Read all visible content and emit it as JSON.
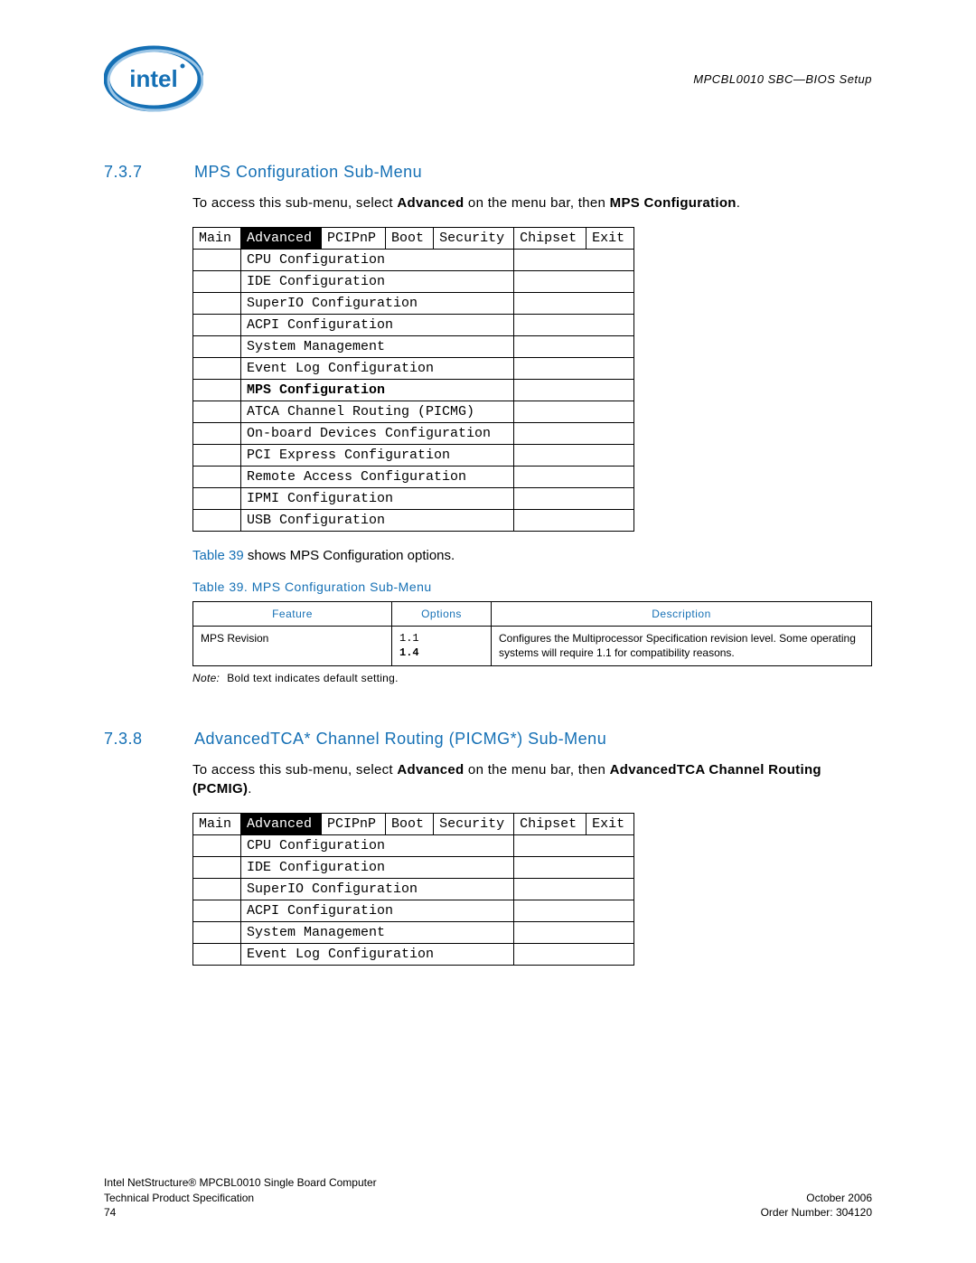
{
  "header": {
    "doc_header_right": "MPCBL0010 SBC—BIOS Setup"
  },
  "section1": {
    "number": "7.3.7",
    "title": "MPS Configuration Sub-Menu",
    "intro_prefix": "To access this sub-menu, select ",
    "intro_bold1": "Advanced",
    "intro_mid": " on the menu bar, then ",
    "intro_bold2": "MPS Configuration",
    "intro_suffix": "."
  },
  "menubar": {
    "main": "Main",
    "advanced": "Advanced",
    "pcipnp": "PCIPnP",
    "boot": "Boot",
    "security": "Security",
    "chipset": "Chipset",
    "exit": "Exit"
  },
  "menu1_items": [
    "CPU Configuration",
    "IDE Configuration",
    "SuperIO Configuration",
    "ACPI Configuration",
    "System Management",
    "Event Log Configuration",
    "MPS Configuration",
    "ATCA Channel Routing (PICMG)",
    "On-board Devices Configuration",
    "PCI Express Configuration",
    "Remote Access Configuration",
    "IPMI Configuration",
    "USB Configuration"
  ],
  "caption1": {
    "link": "Table 39",
    "rest": " shows MPS Configuration options."
  },
  "table39": {
    "caption": "Table 39.   MPS Configuration Sub-Menu",
    "headers": {
      "feature": "Feature",
      "options": "Options",
      "description": "Description"
    },
    "row": {
      "feature": "MPS Revision",
      "opt1": "1.1",
      "opt2": "1.4",
      "desc": "Configures the Multiprocessor Specification revision level. Some operating systems will require 1.1 for compatibility reasons."
    }
  },
  "note": {
    "label": "Note:",
    "text": "Bold text indicates default setting."
  },
  "section2": {
    "number": "7.3.8",
    "title": "AdvancedTCA* Channel Routing (PICMG*) Sub-Menu",
    "intro_prefix": "To access this sub-menu, select ",
    "intro_bold1": "Advanced",
    "intro_mid": " on the menu bar, then ",
    "intro_bold2": "AdvancedTCA Channel Routing (PCMIG)",
    "intro_suffix": "."
  },
  "menu2_items": [
    "CPU Configuration",
    "IDE Configuration",
    "SuperIO Configuration",
    "ACPI Configuration",
    "System Management",
    "Event Log Configuration"
  ],
  "footer": {
    "left1": "Intel NetStructure® MPCBL0010 Single Board Computer",
    "left2": "Technical Product Specification",
    "left3": "74",
    "right1": "October 2006",
    "right2": "Order Number: 304120"
  }
}
